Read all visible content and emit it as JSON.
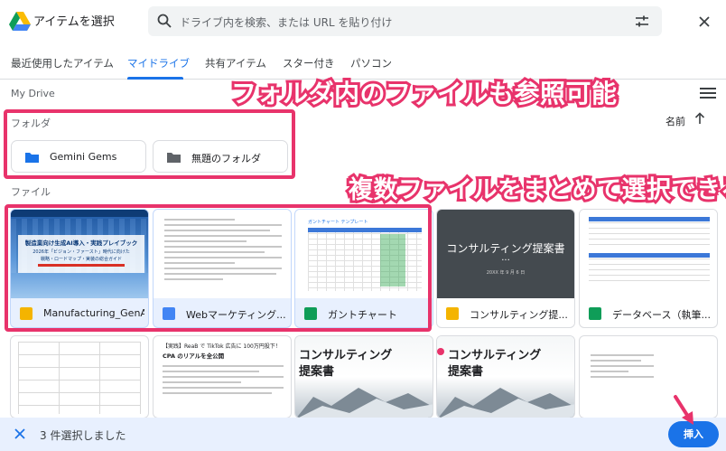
{
  "header": {
    "title": "アイテムを選択",
    "search_placeholder": "ドライブ内を検索、または URL を貼り付け"
  },
  "tabs": [
    {
      "label": "最近使用したアイテム",
      "active": false
    },
    {
      "label": "マイドライブ",
      "active": true
    },
    {
      "label": "共有アイテム",
      "active": false
    },
    {
      "label": "スター付き",
      "active": false
    },
    {
      "label": "パソコン",
      "active": false
    }
  ],
  "breadcrumb": "My Drive",
  "annotations": {
    "folder_note": "フォルダ内のファイルも参照可能",
    "multi_note": "複数ファイルをまとめて選択できる"
  },
  "folders_section": {
    "label": "フォルダ",
    "sort_label": "名前",
    "items": [
      "Gemini Gems",
      "無題のフォルダ"
    ]
  },
  "files_section": {
    "label": "ファイル",
    "items": [
      {
        "name": "Manufacturing_GenAI...",
        "type": "slides",
        "selected": true
      },
      {
        "name": "Webマーケティング...",
        "type": "docs",
        "selected": true
      },
      {
        "name": "ガントチャート",
        "type": "sheets",
        "selected": true
      },
      {
        "name": "コンサルティング提...",
        "type": "slides",
        "selected": false
      },
      {
        "name": "データベース（執筆...",
        "type": "sheets",
        "selected": false
      }
    ]
  },
  "thumbnails": {
    "manufacturing": {
      "title": "製造業向け生成AI導入・実践プレイブック",
      "sub1": "2026年「ビジョン・ファースト」時代に向けた",
      "sub2": "戦略・ロードマップ・実装の総合ガイド"
    },
    "gantt_title": "ガントチャート テンプレート",
    "consulting": {
      "title": "コンサルティング提案書",
      "ellipsis": "...",
      "date": "20XX 年 9 月 6 日"
    },
    "tiktok": {
      "line1": "【実践】ReaB で TikTok 広告に 100万円投下！",
      "line2": "CPA のリアルを全公開"
    },
    "consulting2": {
      "line1": "コンサルティング",
      "line2": "提案書"
    }
  },
  "bottom": {
    "selection_text": "3 件選択しました",
    "insert_label": "挿入"
  },
  "colors": {
    "accent": "#1a73e8",
    "annotation": "#e8336b",
    "slides": "#f4b400",
    "docs": "#4285f4",
    "sheets": "#0f9d58"
  }
}
